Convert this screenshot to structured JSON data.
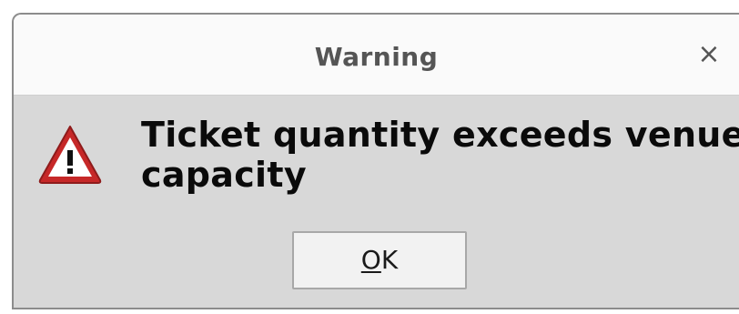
{
  "dialog": {
    "title": "Warning",
    "close_glyph": "×",
    "icon": "warning-triangle-icon",
    "message": "Ticket quantity exceeds venue capacity",
    "ok_button": {
      "mnemonic": "O",
      "rest": "K"
    }
  },
  "colors": {
    "titlebar_bg": "#fafafa",
    "body_bg": "#d8d8d8",
    "icon_red": "#c62828",
    "text": "#0a0a0a"
  }
}
